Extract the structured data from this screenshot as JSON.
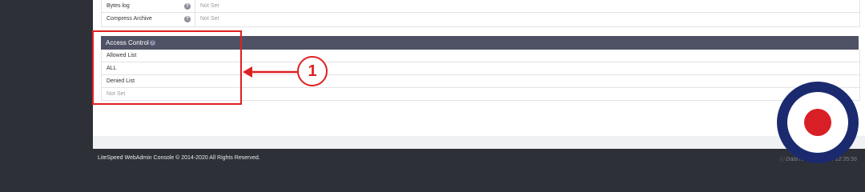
{
  "settings_rows": [
    {
      "label": "Bytes log",
      "value": "Not Set",
      "help_icon": "help-icon"
    },
    {
      "label": "Compress Archive",
      "value": "Not Set",
      "help_icon": "help-icon"
    }
  ],
  "access_control": {
    "title": "Access Control",
    "rows": [
      "Allowed List",
      "ALL",
      "Denied List",
      "Not Set"
    ]
  },
  "callout": {
    "number": "1",
    "color": "#e02020"
  },
  "footer": {
    "copyright": "LiteSpeed WebAdmin Console © 2014-2020 All Rights Reserved.",
    "status": "ⓘ Data retrieved at ... 12:35:56"
  },
  "colors": {
    "header_bg": "#4f5265",
    "page_bg": "#2e3038",
    "annotation_red": "#e02020",
    "roundel_blue": "#1b2a6f",
    "roundel_red": "#d91f26"
  },
  "icons": {
    "help": "help-icon",
    "arrow": "left-arrow-icon",
    "roundel": "roundel-icon"
  }
}
